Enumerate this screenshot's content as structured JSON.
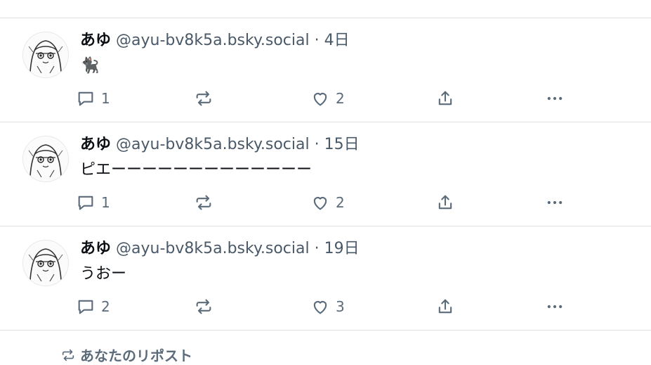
{
  "posts": [
    {
      "author": "あゆ",
      "handle": "@ayu-bv8k5a.bsky.social",
      "separator": "·",
      "time": "4日",
      "text": "🐈‍⬛",
      "reply_count": "1",
      "like_count": "2"
    },
    {
      "author": "あゆ",
      "handle": "@ayu-bv8k5a.bsky.social",
      "separator": "·",
      "time": "15日",
      "text": "ピエーーーーーーーーーーーーー",
      "reply_count": "1",
      "like_count": "2"
    },
    {
      "author": "あゆ",
      "handle": "@ayu-bv8k5a.bsky.social",
      "separator": "·",
      "time": "19日",
      "text": "うおー",
      "reply_count": "2",
      "like_count": "3"
    }
  ],
  "footer": {
    "label": "あなたのリポスト"
  },
  "icons": {
    "reply": "reply-icon",
    "repost": "repost-icon",
    "like": "heart-icon",
    "share": "share-icon",
    "more": "more-icon"
  },
  "colors": {
    "text": "#0b0f14",
    "muted": "#4a5968",
    "divider": "#dfe3e8"
  }
}
